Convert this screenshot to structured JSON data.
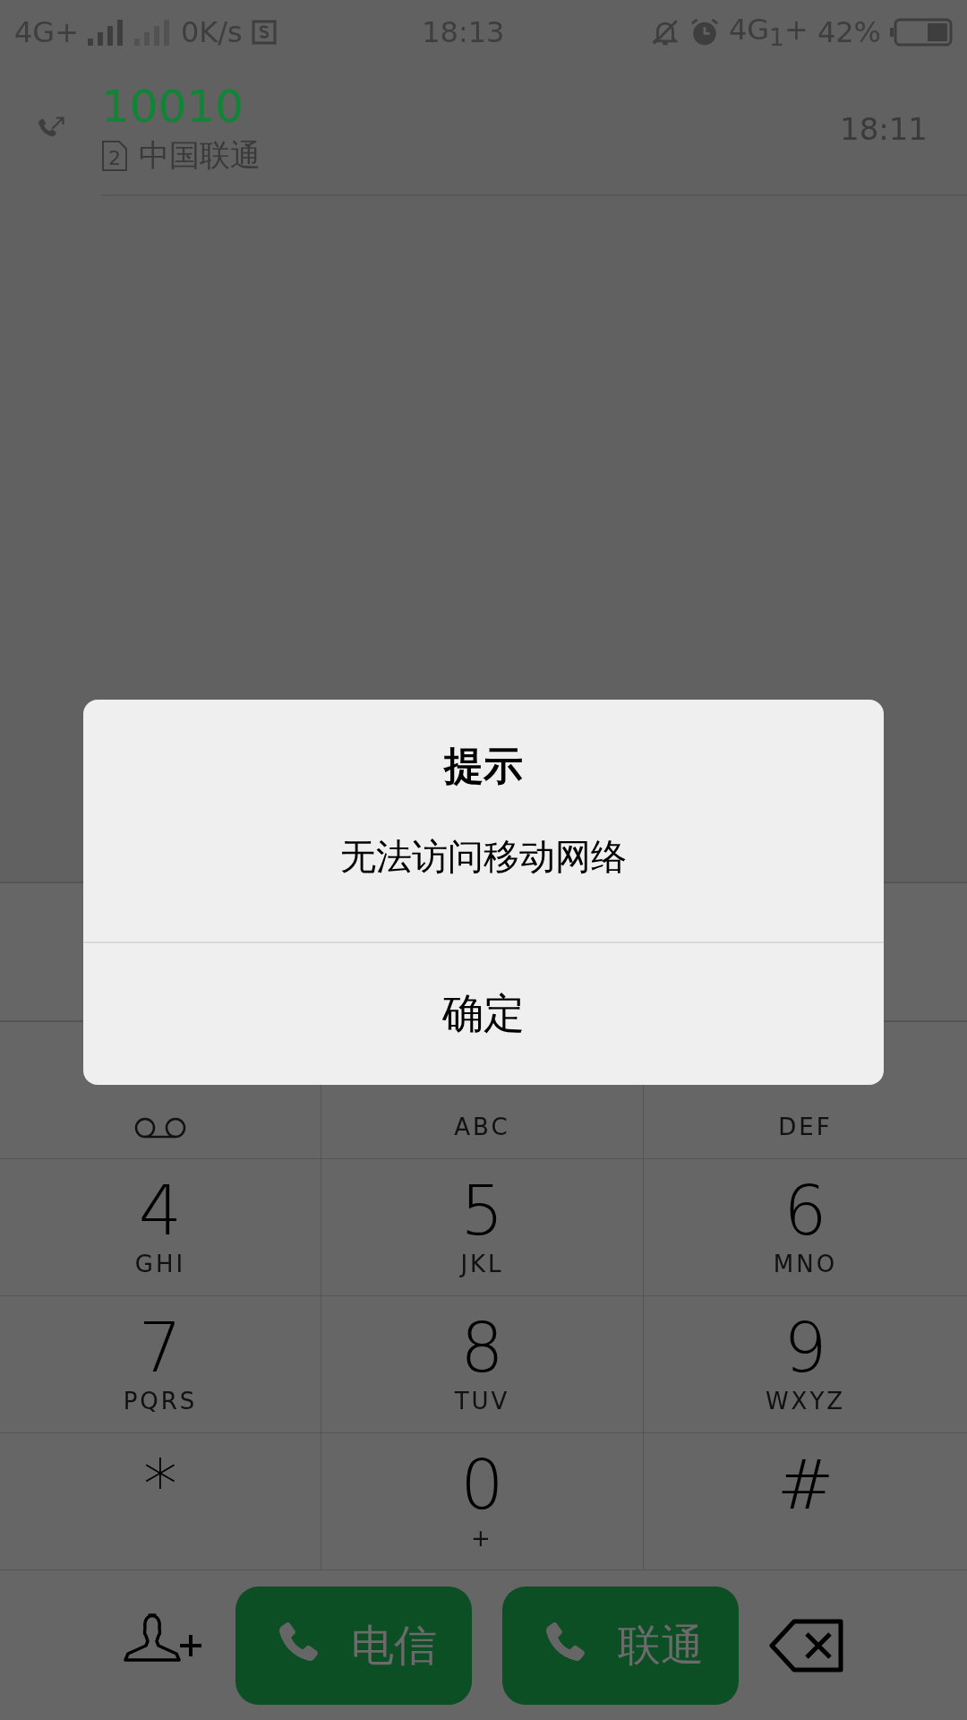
{
  "status_bar": {
    "network_1": "4G+",
    "speed": "0K/s",
    "time": "18:13",
    "network_2": "4G$_{1}$+",
    "battery": "42%"
  },
  "call_log": [
    {
      "number": "10010",
      "sim": "2",
      "carrier": "中国联通",
      "time": "18:11"
    }
  ],
  "dialog": {
    "title": "提示",
    "message": "无法访问移动网络",
    "button": "确定"
  },
  "keypad": [
    {
      "kind": "voicemail"
    },
    {
      "kind": "letters",
      "sub": "ABC"
    },
    {
      "kind": "letters",
      "sub": "DEF"
    },
    {
      "digit": "4",
      "kind": "letters",
      "sub": "GHI"
    },
    {
      "digit": "5",
      "kind": "letters",
      "sub": "JKL"
    },
    {
      "digit": "6",
      "kind": "letters",
      "sub": "MNO"
    },
    {
      "digit": "7",
      "kind": "letters",
      "sub": "PQRS"
    },
    {
      "digit": "8",
      "kind": "letters",
      "sub": "TUV"
    },
    {
      "digit": "9",
      "kind": "letters",
      "sub": "WXYZ"
    },
    {
      "digit": "*",
      "kind": "plain"
    },
    {
      "digit": "0",
      "kind": "letters",
      "sub": "+"
    },
    {
      "digit": "#",
      "kind": "plain"
    }
  ],
  "call_buttons": [
    {
      "label": "电信"
    },
    {
      "label": "联通"
    }
  ]
}
